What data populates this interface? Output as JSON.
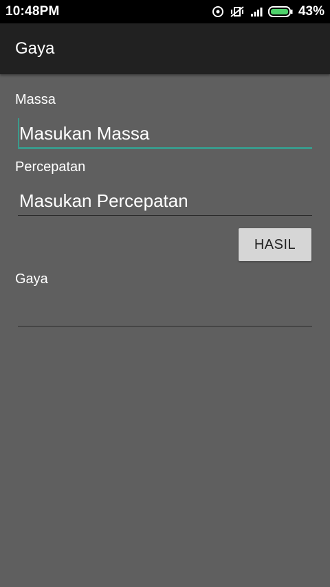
{
  "status_bar": {
    "time": "10:48PM",
    "battery_percent": "43%",
    "icons": [
      "data-saver-icon",
      "vibrate-alarm-icon",
      "signal-icon",
      "battery-icon"
    ]
  },
  "app_bar": {
    "title": "Gaya"
  },
  "form": {
    "massa_label": "Massa",
    "massa_placeholder": "Masukan Massa",
    "massa_value": "",
    "percepatan_label": "Percepatan",
    "percepatan_placeholder": "Masukan Percepatan",
    "percepatan_value": "",
    "hasil_button": "HASIL",
    "gaya_label": "Gaya",
    "gaya_value": ""
  },
  "colors": {
    "background": "#5f5f5f",
    "app_bar": "#212121",
    "status_bar": "#000000",
    "accent": "#3a9a8c",
    "button": "#d6d6d6"
  }
}
